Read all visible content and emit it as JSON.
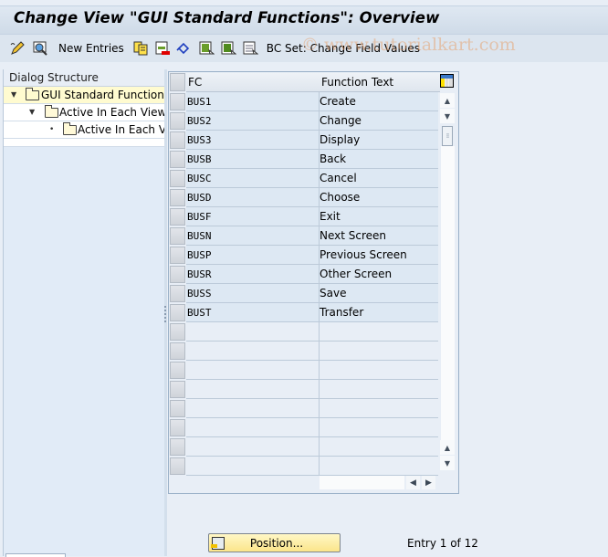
{
  "title": "Change View \"GUI Standard Functions\": Overview",
  "toolbar": {
    "items": [
      {
        "icon": "edit-pencil-icon"
      },
      {
        "icon": "display-change-icon"
      },
      {
        "label": "New Entries"
      },
      {
        "icon": "copy-icon"
      },
      {
        "icon": "delete-icon"
      },
      {
        "icon": "undo-icon"
      },
      {
        "icon": "select-all-icon"
      },
      {
        "icon": "select-block-icon"
      },
      {
        "icon": "deselect-all-icon"
      },
      {
        "label": "BC Set: Change Field Values"
      }
    ],
    "new_entries_label": "New Entries",
    "bc_set_label": "BC Set: Change Field Values"
  },
  "watermark": "© www.tutorialkart.com",
  "dialog_structure": {
    "header": "Dialog Structure",
    "nodes": [
      {
        "label": "GUI Standard Functions",
        "level": 0,
        "expanded": true,
        "selected": true
      },
      {
        "label": "Active In Each View",
        "level": 1,
        "expanded": true,
        "selected": false
      },
      {
        "label": "Active In Each View",
        "level": 2,
        "expanded": false,
        "selected": false
      }
    ]
  },
  "table": {
    "columns": [
      "FC",
      "Function Text"
    ],
    "rows": [
      {
        "fc": "BUS1",
        "text": "Create"
      },
      {
        "fc": "BUS2",
        "text": "Change"
      },
      {
        "fc": "BUS3",
        "text": "Display"
      },
      {
        "fc": "BUSB",
        "text": "Back"
      },
      {
        "fc": "BUSC",
        "text": "Cancel"
      },
      {
        "fc": "BUSD",
        "text": "Choose"
      },
      {
        "fc": "BUSF",
        "text": "Exit"
      },
      {
        "fc": "BUSN",
        "text": "Next Screen"
      },
      {
        "fc": "BUSP",
        "text": "Previous Screen"
      },
      {
        "fc": "BUSR",
        "text": "Other Screen"
      },
      {
        "fc": "BUSS",
        "text": "Save"
      },
      {
        "fc": "BUST",
        "text": "Transfer"
      }
    ],
    "empty_rows": 8
  },
  "footer": {
    "position_button": "Position...",
    "entry_info": "Entry 1 of 12"
  },
  "colors": {
    "selected_node": "#fffbd0",
    "position_button": "#fbe58a",
    "row_fill": "#dde8f3"
  }
}
